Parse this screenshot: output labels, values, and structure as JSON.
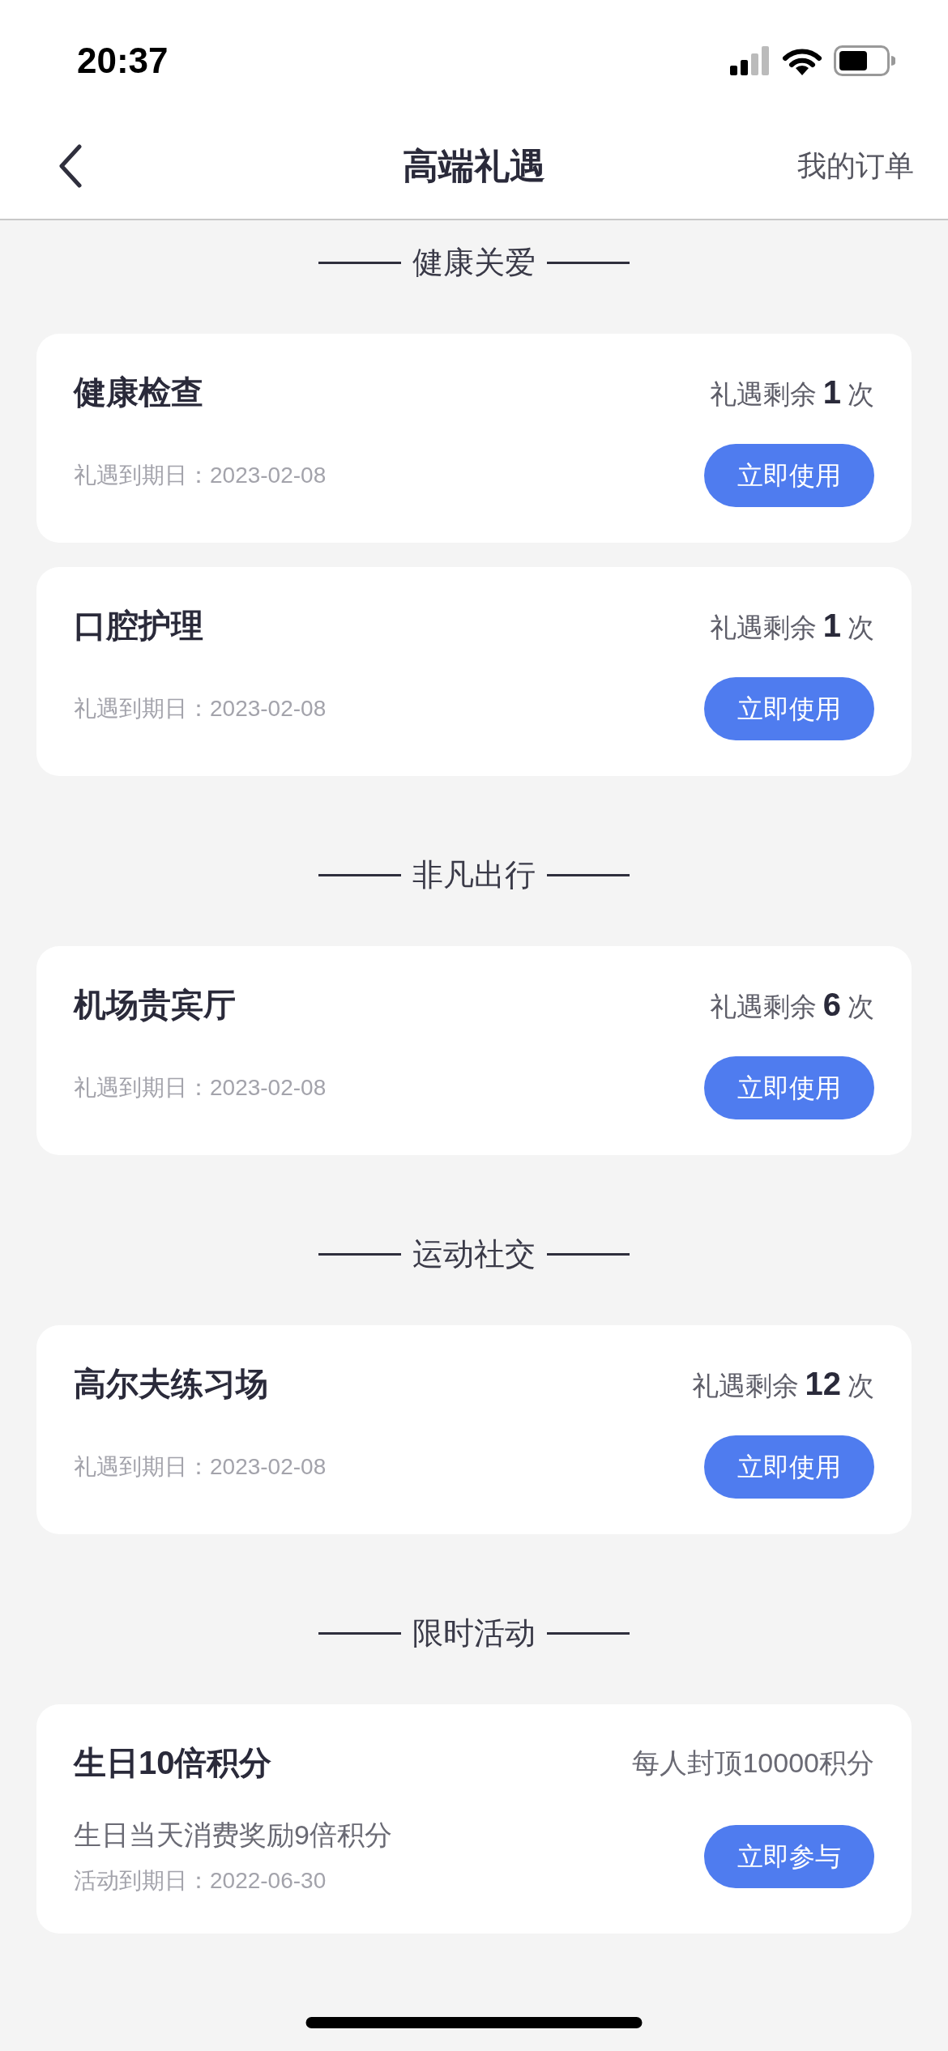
{
  "status_bar": {
    "time": "20:37"
  },
  "nav": {
    "title": "高端礼遇",
    "action": "我的订单"
  },
  "sections": [
    {
      "title": "健康关爱",
      "cards": [
        {
          "kind": "benefit",
          "title": "健康检查",
          "quota": {
            "prefix": "礼遇剩余",
            "count": "1",
            "suffix": "次"
          },
          "expiry": "礼遇到期日：2023-02-08",
          "button": "立即使用"
        },
        {
          "kind": "benefit",
          "title": "口腔护理",
          "quota": {
            "prefix": "礼遇剩余",
            "count": "1",
            "suffix": "次"
          },
          "expiry": "礼遇到期日：2023-02-08",
          "button": "立即使用"
        }
      ]
    },
    {
      "title": "非凡出行",
      "cards": [
        {
          "kind": "benefit",
          "title": "机场贵宾厅",
          "quota": {
            "prefix": "礼遇剩余",
            "count": "6",
            "suffix": "次"
          },
          "expiry": "礼遇到期日：2023-02-08",
          "button": "立即使用"
        }
      ]
    },
    {
      "title": "运动社交",
      "cards": [
        {
          "kind": "benefit",
          "title": "高尔夫练习场",
          "quota": {
            "prefix": "礼遇剩余",
            "count": "12",
            "suffix": "次"
          },
          "expiry": "礼遇到期日：2023-02-08",
          "button": "立即使用"
        }
      ]
    },
    {
      "title": "限时活动",
      "cards": [
        {
          "kind": "activity",
          "title": "生日10倍积分",
          "note": "每人封顶10000积分",
          "description": "生日当天消费奖励9倍积分",
          "expiry": "活动到期日：2022-06-30",
          "button": "立即参与"
        }
      ]
    }
  ]
}
